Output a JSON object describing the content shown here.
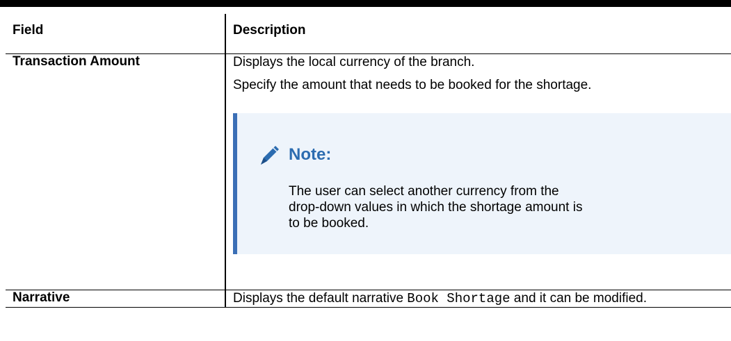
{
  "table": {
    "headers": {
      "field": "Field",
      "description": "Description"
    },
    "rows": [
      {
        "field": "Transaction Amount",
        "lines": [
          "Displays the local currency of the branch.",
          "Specify the amount that needs to be booked for the shortage."
        ],
        "note": {
          "icon": "pencil-icon",
          "title": "Note:",
          "text": "The user can select another currency from the drop-down values in which the shortage amount is to be booked."
        }
      },
      {
        "field": "Narrative",
        "text_before": "Displays the default narrative ",
        "code": "Book Shortage",
        "text_after": " and it can be modified."
      }
    ]
  },
  "colors": {
    "note_accent": "#3b6fb6",
    "note_background": "#eef4fb",
    "note_title": "#2c6cb0"
  }
}
